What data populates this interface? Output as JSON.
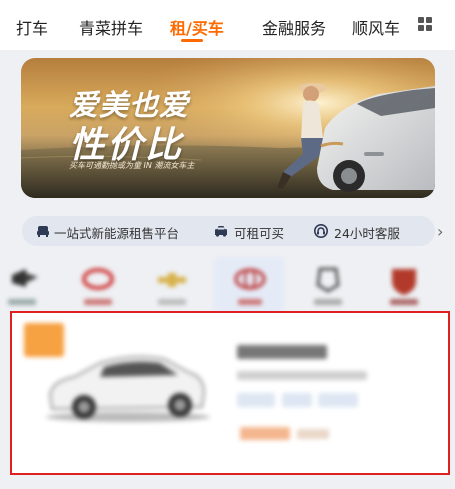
{
  "nav": {
    "tabs": [
      {
        "label": "打车",
        "active": false
      },
      {
        "label": "青菜拼车",
        "active": false
      },
      {
        "label": "租/买车",
        "active": true
      },
      {
        "label": "金融服务",
        "active": false
      },
      {
        "label": "顺风车",
        "active": false
      }
    ],
    "more_icon": "grid-icon",
    "accent_color": "#ff6a00"
  },
  "banner": {
    "line1": "爱美也爱",
    "line2": "性价比",
    "sub": "买车可通勤抛或为童 IN 潮流女车主"
  },
  "features": {
    "items": [
      {
        "icon": "sofa-icon",
        "label": "一站式新能源租售平台"
      },
      {
        "icon": "car-icon",
        "label": "可租可买"
      },
      {
        "icon": "headset-icon",
        "label": "24小时客服"
      }
    ],
    "more_icon": "chevron-right-icon"
  },
  "brands": {
    "count": 6,
    "selected_index": 4
  },
  "listing": {
    "highlight_color": "#e02020"
  }
}
